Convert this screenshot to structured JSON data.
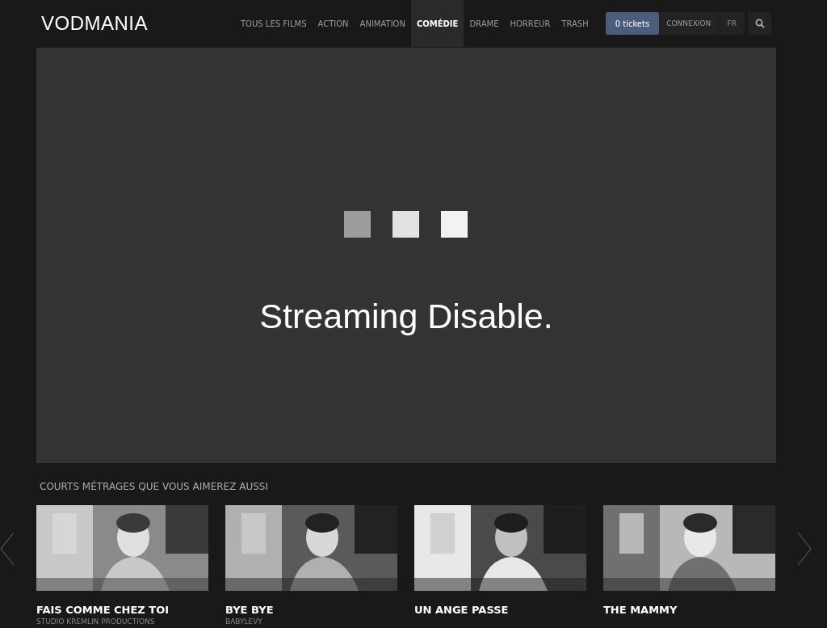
{
  "header": {
    "logo": "VODMANIA",
    "nav": [
      {
        "label": "TOUS LES FILMS",
        "selected": false
      },
      {
        "label": "ACTION",
        "selected": false
      },
      {
        "label": "ANIMATION",
        "selected": false
      },
      {
        "label": "COMÉDIE",
        "selected": true
      },
      {
        "label": "DRAME",
        "selected": false
      },
      {
        "label": "HORREUR",
        "selected": false
      },
      {
        "label": "TRASH",
        "selected": false
      }
    ],
    "tickets": "0 tickets",
    "login": "CONNEXION",
    "language": "FR"
  },
  "player": {
    "message": "Streaming Disable."
  },
  "related": {
    "title": "COURTS MÉTRAGES QUE VOUS AIMEREZ AUSSI",
    "films": [
      {
        "title": "FAIS COMME CHEZ TOI",
        "studio": "STUDIO KREMLIN PRODUCTIONS",
        "kind": "picture"
      },
      {
        "title": "BYE BYE",
        "studio": "BABYLEVY",
        "kind": "picture"
      },
      {
        "title": "UN ANGE PASSE",
        "kind": "picture"
      },
      {
        "title": "THE MAMMY",
        "kind": "picture"
      }
    ]
  }
}
